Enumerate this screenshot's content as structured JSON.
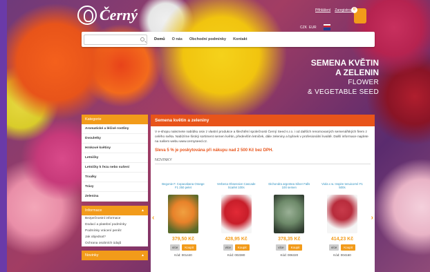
{
  "brand": {
    "name": "Černý"
  },
  "toplinks": [
    "Přihlášení",
    "Zaregistrovat se"
  ],
  "currency": [
    "CZK",
    "EUR"
  ],
  "cart": {
    "count": "0"
  },
  "search": {
    "placeholder": "",
    "value": ""
  },
  "nav": [
    "Domů",
    "O nás",
    "Obchodní podmínky",
    "Kontakt"
  ],
  "banner": {
    "line1": "SEMENA KVĚTIN",
    "line2": "A ZELENIN",
    "line3": "FLOWER",
    "line4": "& VEGETABLE SEED"
  },
  "categories": {
    "title": "Kategorie",
    "items": [
      "Aromatické a léčivé rostliny",
      "Dvouletky",
      "Hrnkové květiny",
      "Letničky",
      "Letničky k řezu nebo sušení",
      "Trvalky",
      "Trávy",
      "Zelenina"
    ]
  },
  "information": {
    "title": "Informace",
    "items": [
      "Bezpečnostní informace",
      "Dodací a platební podmínky",
      "Podmínky vrácení peněz",
      "Jak objednat?",
      "Ochrana osobních údajů"
    ]
  },
  "novinky_box": {
    "title": "Novinky"
  },
  "main": {
    "title": "Semena květin a zeleniny",
    "intro": "V e-shopu naleznete nabídku osiv z vlastní produkce a šlechtění společnosti Černý Seed s.r.o. i od dalších renomovaných semenářských firem z celého světa. Nabízíme široký sortiment semen květin, především letniček, dále zeleniny a bylinek v profesionální kvalitě. Další informace najdete na našem webu www.cernyseed.cz.",
    "discount": "Sleva 5 % je poskytována při nákupu nad 2 500 Kč bez DPH.",
    "section": "NOVINKY"
  },
  "products": [
    {
      "name": "Begonie F. Copacabana Orange F1 250 pelet",
      "price": "379,50 Kč",
      "more": "více",
      "buy": "Koupit",
      "code": "Kód: 001440",
      "color": "#e8822a"
    },
    {
      "name": "Verbena Obsession Cascade Scarlet 100s",
      "price": "428,95 Kč",
      "more": "více",
      "buy": "Koupit",
      "code": "Kód: 002380",
      "color": "#c81e2a"
    },
    {
      "name": "Dichondra argentea Silver Falls 100 semen",
      "price": "378,35 Kč",
      "more": "více",
      "buy": "Koupit",
      "code": "Kód: 006320",
      "color": "#6e8a6a"
    },
    {
      "name": "Viola x w. Inspire tenuicorné F1 500s",
      "price": "414,23 Kč",
      "more": "více",
      "buy": "Koupit",
      "code": "Kód: 004160",
      "color": "#b82c3c"
    }
  ],
  "arrows": {
    "prev": "‹",
    "next": "›"
  },
  "colors": {
    "accent": "#f29b1a",
    "header": "#e8541a"
  }
}
